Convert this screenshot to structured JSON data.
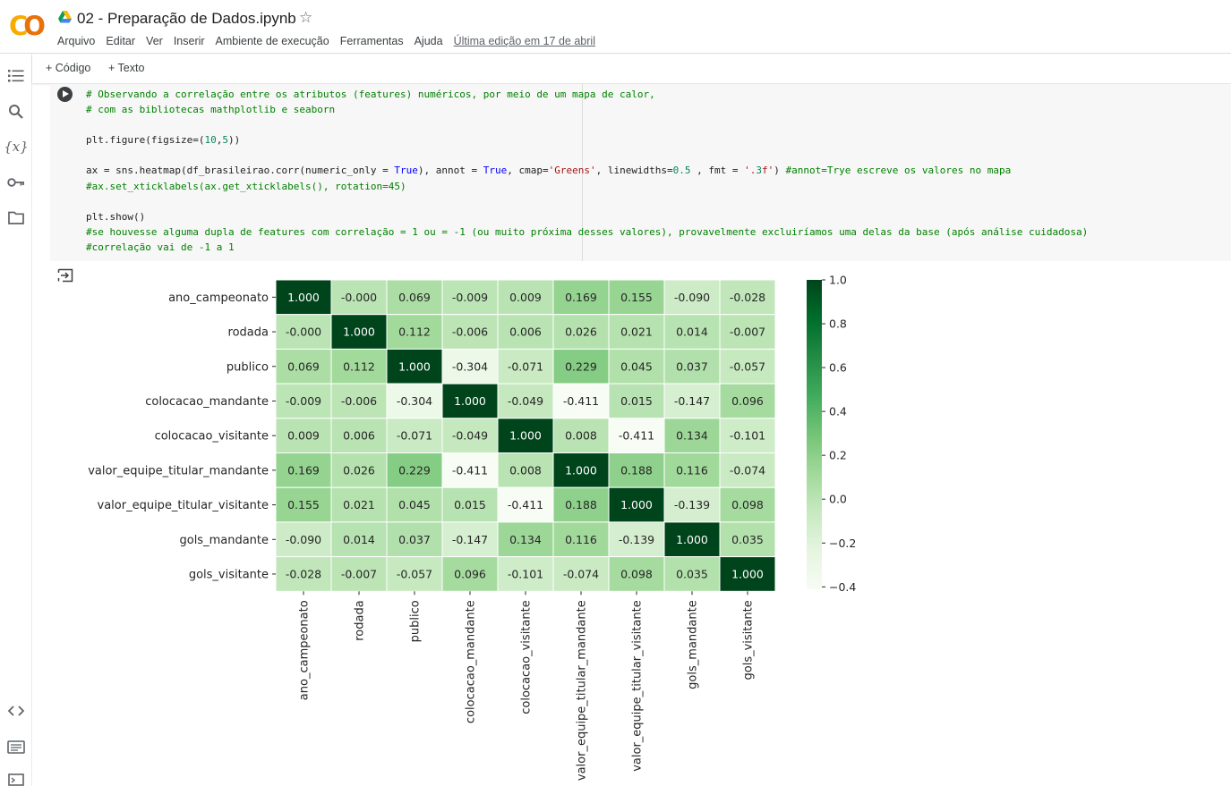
{
  "notebook": {
    "title": "02 - Preparação de Dados.ipynb",
    "last_edit": "Última edição em 17 de abril"
  },
  "menu": [
    "Arquivo",
    "Editar",
    "Ver",
    "Inserir",
    "Ambiente de execução",
    "Ferramentas",
    "Ajuda"
  ],
  "toolbar": {
    "add_code": "+ Código",
    "add_text": "+ Texto"
  },
  "sidebar_icons": [
    "table-of-contents-icon",
    "search-icon",
    "variables-icon",
    "key-icon",
    "folder-icon",
    "code-snippets-icon",
    "command-palette-icon",
    "terminal-icon"
  ],
  "cell": {
    "lines": [
      "# Observando a correlação entre os atributos (features) numéricos, por meio de um mapa de calor,",
      "# com as bibliotecas mathplotlib e seaborn",
      "",
      "plt.figure(figsize=(10,5))",
      "",
      "ax = sns.heatmap(df_brasileirao.corr(numeric_only = True), annot = True, cmap='Greens', linewidths=0.5 , fmt = '.3f') #annot=Trye escreve os valores no mapa",
      "#ax.set_xticklabels(ax.get_xticklabels(), rotation=45)",
      "",
      "plt.show()",
      "#se houvesse alguma dupla de features com correlação = 1 ou = -1 (ou muito próxima desses valores), provavelmente excluiríamos uma delas da base (após análise cuidadosa)",
      "#correlação vai de -1 a 1"
    ]
  },
  "chart_data": {
    "type": "heatmap",
    "colormap": "Greens",
    "labels": [
      "ano_campeonato",
      "rodada",
      "publico",
      "colocacao_mandante",
      "colocacao_visitante",
      "valor_equipe_titular_mandante",
      "valor_equipe_titular_visitante",
      "gols_mandante",
      "gols_visitante"
    ],
    "matrix": [
      [
        1.0,
        -0.0,
        0.069,
        -0.009,
        0.009,
        0.169,
        0.155,
        -0.09,
        -0.028
      ],
      [
        -0.0,
        1.0,
        0.112,
        -0.006,
        0.006,
        0.026,
        0.021,
        0.014,
        -0.007
      ],
      [
        0.069,
        0.112,
        1.0,
        -0.304,
        -0.071,
        0.229,
        0.045,
        0.037,
        -0.057
      ],
      [
        -0.009,
        -0.006,
        -0.304,
        1.0,
        -0.049,
        -0.411,
        0.015,
        -0.147,
        0.096
      ],
      [
        0.009,
        0.006,
        -0.071,
        -0.049,
        1.0,
        0.008,
        -0.411,
        0.134,
        -0.101
      ],
      [
        0.169,
        0.026,
        0.229,
        -0.411,
        0.008,
        1.0,
        0.188,
        0.116,
        -0.074
      ],
      [
        0.155,
        0.021,
        0.045,
        0.015,
        -0.411,
        0.188,
        1.0,
        -0.139,
        0.098
      ],
      [
        -0.09,
        0.014,
        0.037,
        -0.147,
        0.134,
        0.116,
        -0.139,
        1.0,
        0.035
      ],
      [
        -0.028,
        -0.007,
        -0.057,
        0.096,
        -0.101,
        -0.074,
        0.098,
        0.035,
        1.0
      ]
    ],
    "annotations": [
      [
        "1.000",
        "-0.000",
        "0.069",
        "-0.009",
        "0.009",
        "0.169",
        "0.155",
        "-0.090",
        "-0.028"
      ],
      [
        "-0.000",
        "1.000",
        "0.112",
        "-0.006",
        "0.006",
        "0.026",
        "0.021",
        "0.014",
        "-0.007"
      ],
      [
        "0.069",
        "0.112",
        "1.000",
        "-0.304",
        "-0.071",
        "0.229",
        "0.045",
        "0.037",
        "-0.057"
      ],
      [
        "-0.009",
        "-0.006",
        "-0.304",
        "1.000",
        "-0.049",
        "-0.411",
        "0.015",
        "-0.147",
        "0.096"
      ],
      [
        "0.009",
        "0.006",
        "-0.071",
        "-0.049",
        "1.000",
        "0.008",
        "-0.411",
        "0.134",
        "-0.101"
      ],
      [
        "0.169",
        "0.026",
        "0.229",
        "-0.411",
        "0.008",
        "1.000",
        "0.188",
        "0.116",
        "-0.074"
      ],
      [
        "0.155",
        "0.021",
        "0.045",
        "0.015",
        "-0.411",
        "0.188",
        "1.000",
        "-0.139",
        "0.098"
      ],
      [
        "-0.090",
        "0.014",
        "0.037",
        "-0.147",
        "0.134",
        "0.116",
        "-0.139",
        "1.000",
        "0.035"
      ],
      [
        "-0.028",
        "-0.007",
        "-0.057",
        "0.096",
        "-0.101",
        "-0.074",
        "0.098",
        "0.035",
        "1.000"
      ]
    ],
    "vmin": -0.411,
    "vmax": 1.0,
    "colorbar_ticks": [
      "1.0",
      "0.8",
      "0.6",
      "0.4",
      "0.2",
      "0.0",
      "−0.2",
      "−0.4"
    ],
    "colorbar_tick_values": [
      1.0,
      0.8,
      0.6,
      0.4,
      0.2,
      0.0,
      -0.2,
      -0.4
    ]
  }
}
